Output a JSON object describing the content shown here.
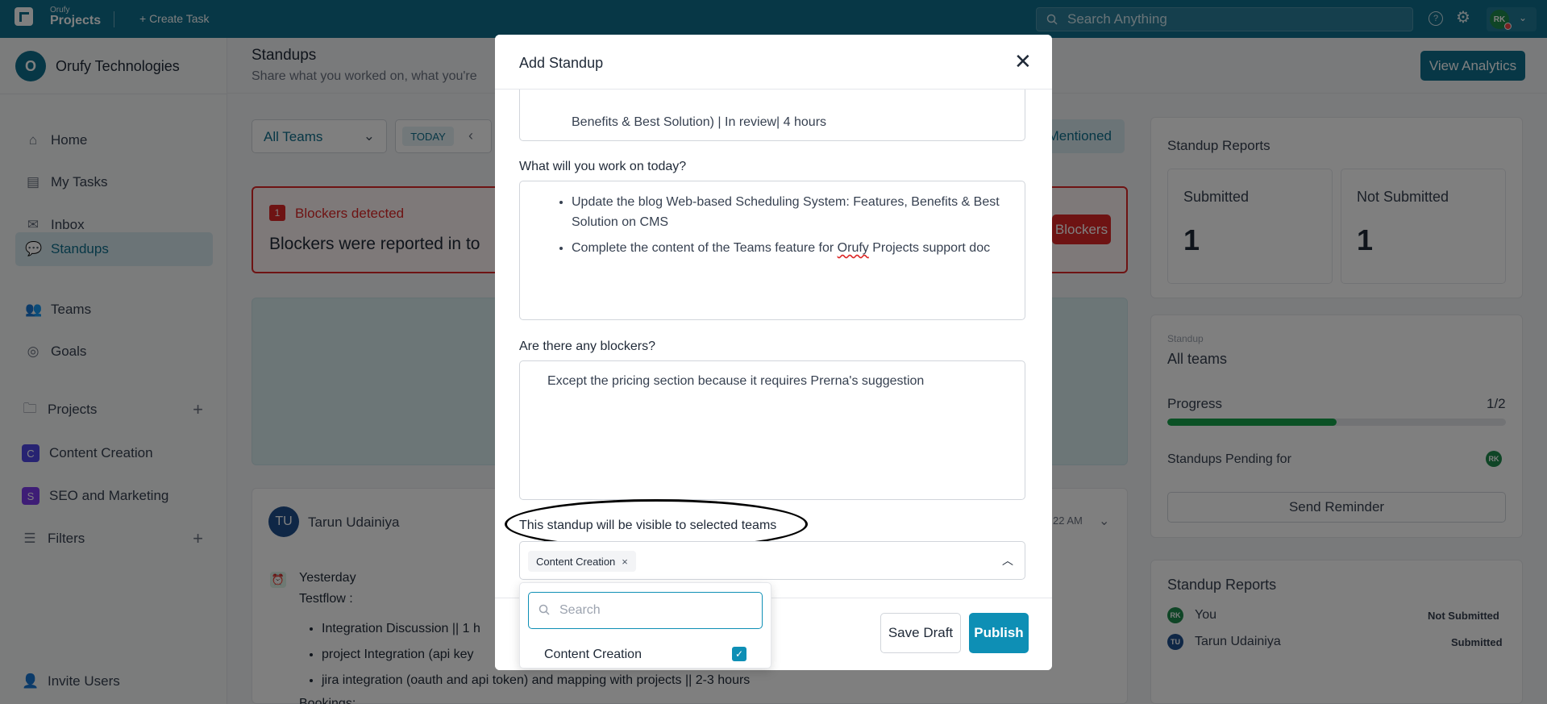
{
  "topbar": {
    "brand_small": "Orufy",
    "brand_big": "Projects",
    "create_task": "+ Create Task",
    "search_placeholder": "Search Anything",
    "user_initials": "RK"
  },
  "sidebar": {
    "org_initial": "O",
    "org_name": "Orufy Technologies",
    "items": [
      {
        "label": "Home"
      },
      {
        "label": "My Tasks"
      },
      {
        "label": "Inbox"
      },
      {
        "label": "Standups"
      },
      {
        "label": "Teams"
      },
      {
        "label": "Goals"
      }
    ],
    "projects_label": "Projects",
    "projects": [
      {
        "initial": "C",
        "label": "Content Creation",
        "color": "#4f46e5"
      },
      {
        "initial": "S",
        "label": "SEO and Marketing",
        "color": "#7c3aed"
      }
    ],
    "filters_label": "Filters",
    "invite_users": "Invite Users"
  },
  "main": {
    "title": "Standups",
    "subtitle": "Share what you worked on, what you're",
    "view_analytics": "View Analytics",
    "team_filter": "All Teams",
    "today": "TODAY",
    "mentioned": "Mentioned",
    "blocker_count": "1",
    "blocker_title": "Blockers detected",
    "blocker_text": "Blockers were reported in to",
    "blockers_button": "Blockers",
    "card": {
      "initials": "TU",
      "name": "Tarun Udainiya",
      "time": "22 AM",
      "yesterday": "Yesterday",
      "testflow": "Testflow :",
      "items": [
        "Integration Discussion || 1 h",
        "project Integration (api key",
        "jira integration (oauth and api token) and mapping with projects || 2-3 hours"
      ],
      "bookings": "Bookings:"
    }
  },
  "right": {
    "reports_title": "Standup Reports",
    "submitted_label": "Submitted",
    "submitted_value": "1",
    "not_submitted_label": "Not Submitted",
    "not_submitted_value": "1",
    "standup_caption": "Standup",
    "all_teams": "All teams",
    "progress_label": "Progress",
    "progress_value": "1/2",
    "progress_fraction": 0.5,
    "pending_label": "Standups Pending for",
    "pending_initials": "RK",
    "send_reminder": "Send Reminder",
    "reports2_title": "Standup Reports",
    "report_rows": [
      {
        "initials": "RK",
        "name": "You",
        "status": "Not Submitted",
        "color": "#1e8a4c"
      },
      {
        "initials": "TU",
        "name": "Tarun Udainiya",
        "status": "Submitted",
        "color": "#1e4e8c"
      }
    ]
  },
  "modal": {
    "title": "Add Standup",
    "prev_text": "Benefits & Best Solution) | In review| 4 hours",
    "today_question": "What will you work on today?",
    "today_items": [
      "Update the blog Web-based Scheduling System: Features, Benefits & Best Solution on CMS",
      "Complete the content of the Teams feature for Orufy Projects support doc"
    ],
    "blockers_question": "Are there any blockers?",
    "blockers_answer": "Except the pricing section because it requires Prerna's suggestion",
    "teams_label": "This standup will be visible to selected teams",
    "selected_team": "Content Creation",
    "save_draft": "Save Draft",
    "publish": "Publish"
  },
  "dropdown": {
    "search_placeholder": "Search",
    "option": "Content Creation",
    "option_checked": true
  }
}
